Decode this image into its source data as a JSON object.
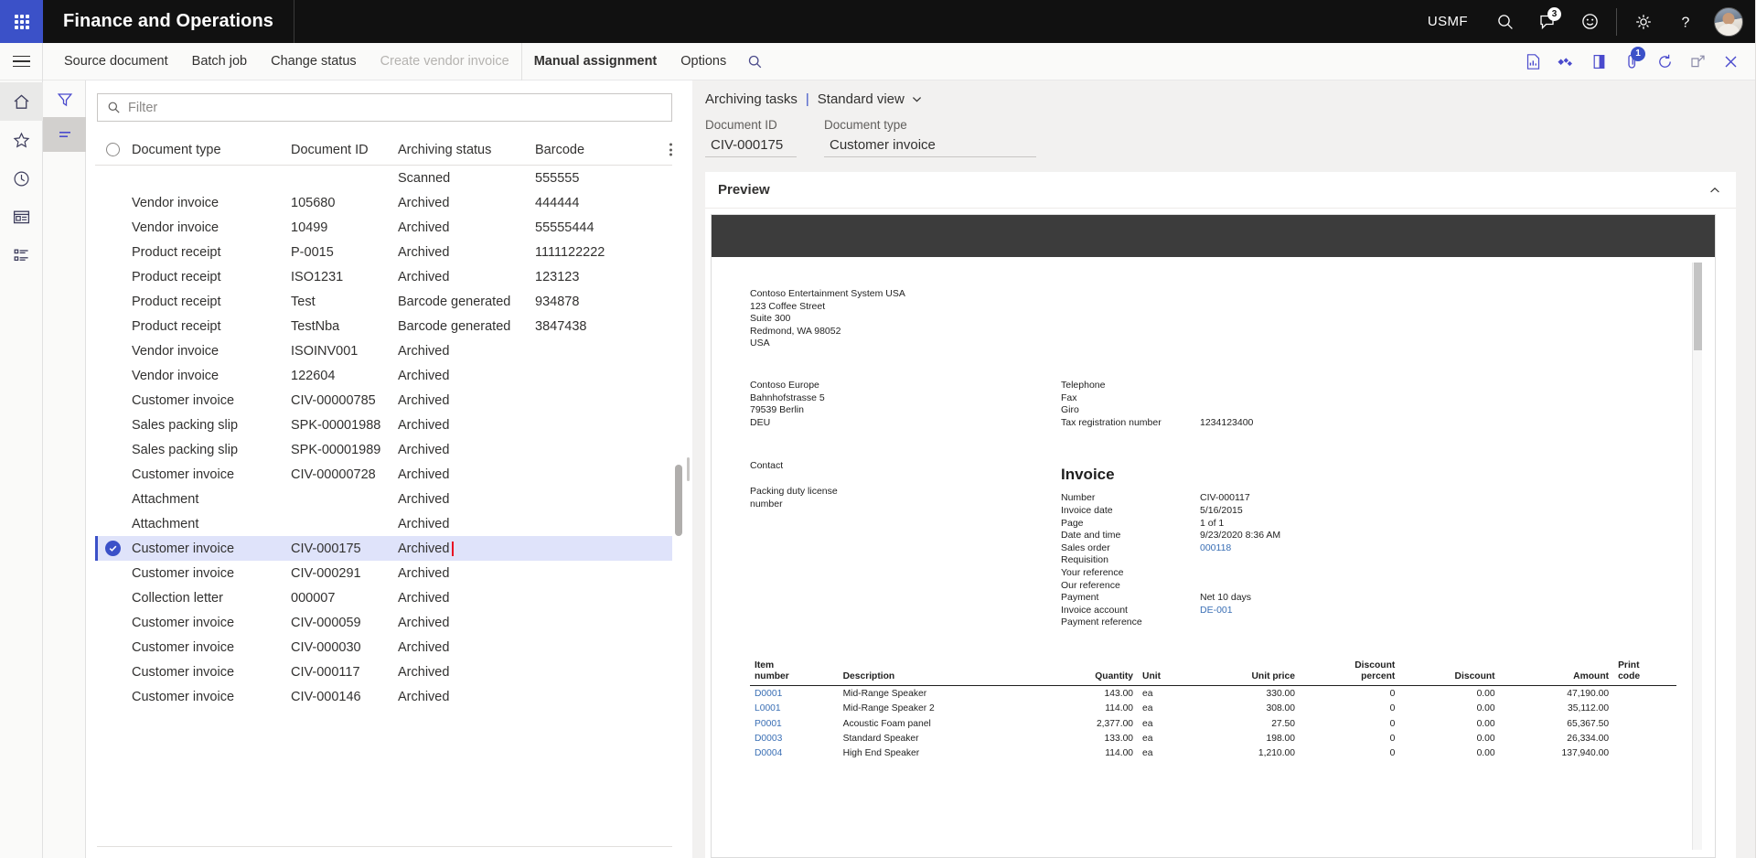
{
  "topbar": {
    "app_title": "Finance and Operations",
    "company": "USMF",
    "search_icon": "search-icon",
    "notifications_badge": "3",
    "feedback_icon": "smiley-icon",
    "settings_icon": "gear-icon",
    "help_icon": "question-mark-icon"
  },
  "toolbar": {
    "tabs": [
      {
        "label": "Source document",
        "state": "normal"
      },
      {
        "label": "Batch job",
        "state": "normal"
      },
      {
        "label": "Change status",
        "state": "normal"
      },
      {
        "label": "Create vendor invoice",
        "state": "disabled"
      },
      {
        "label": "Manual assignment",
        "state": "active"
      },
      {
        "label": "Options",
        "state": "normal"
      }
    ],
    "right_icons": [
      {
        "name": "report-icon",
        "badge": ""
      },
      {
        "name": "share-icon",
        "badge": ""
      },
      {
        "name": "book-icon",
        "badge": ""
      },
      {
        "name": "attachment-icon",
        "badge": "1"
      },
      {
        "name": "refresh-icon",
        "badge": ""
      },
      {
        "name": "open-in-new-icon",
        "badge": ""
      },
      {
        "name": "close-icon",
        "badge": ""
      }
    ]
  },
  "rail": {
    "items": [
      {
        "name": "home-icon"
      },
      {
        "name": "favorites-star-icon"
      },
      {
        "name": "recent-clock-icon"
      },
      {
        "name": "workspaces-icon"
      },
      {
        "name": "modules-list-icon"
      }
    ]
  },
  "filter_rail": {
    "items": [
      {
        "name": "filter-funnel-icon",
        "selected": false
      },
      {
        "name": "lines-view-icon",
        "selected": true
      }
    ]
  },
  "grid": {
    "filter_placeholder": "Filter",
    "filter_value": "",
    "columns": [
      "Document type",
      "Document ID",
      "Archiving status",
      "Barcode"
    ],
    "rows": [
      {
        "type": "",
        "id": "",
        "status": "Scanned",
        "barcode": "555555",
        "selected": false,
        "highlight": false
      },
      {
        "type": "Vendor invoice",
        "id": "105680",
        "status": "Archived",
        "barcode": "444444",
        "selected": false,
        "highlight": false
      },
      {
        "type": "Vendor invoice",
        "id": "10499",
        "status": "Archived",
        "barcode": "55555444",
        "selected": false,
        "highlight": false
      },
      {
        "type": "Product receipt",
        "id": "P-0015",
        "status": "Archived",
        "barcode": "1111122222",
        "selected": false,
        "highlight": false
      },
      {
        "type": "Product receipt",
        "id": "ISO1231",
        "status": "Archived",
        "barcode": "123123",
        "selected": false,
        "highlight": false
      },
      {
        "type": "Product receipt",
        "id": "Test",
        "status": "Barcode generated",
        "barcode": "934878",
        "selected": false,
        "highlight": false
      },
      {
        "type": "Product receipt",
        "id": "TestNba",
        "status": "Barcode generated",
        "barcode": "3847438",
        "selected": false,
        "highlight": false
      },
      {
        "type": "Vendor invoice",
        "id": "ISOINV001",
        "status": "Archived",
        "barcode": "",
        "selected": false,
        "highlight": false
      },
      {
        "type": "Vendor invoice",
        "id": "122604",
        "status": "Archived",
        "barcode": "",
        "selected": false,
        "highlight": false
      },
      {
        "type": "Customer invoice",
        "id": "CIV-00000785",
        "status": "Archived",
        "barcode": "",
        "selected": false,
        "highlight": false
      },
      {
        "type": "Sales packing slip",
        "id": "SPK-00001988",
        "status": "Archived",
        "barcode": "",
        "selected": false,
        "highlight": false
      },
      {
        "type": "Sales packing slip",
        "id": "SPK-00001989",
        "status": "Archived",
        "barcode": "",
        "selected": false,
        "highlight": false
      },
      {
        "type": "Customer invoice",
        "id": "CIV-00000728",
        "status": "Archived",
        "barcode": "",
        "selected": false,
        "highlight": false
      },
      {
        "type": "Attachment",
        "id": "",
        "status": "Archived",
        "barcode": "",
        "selected": false,
        "highlight": false
      },
      {
        "type": "Attachment",
        "id": "",
        "status": "Archived",
        "barcode": "",
        "selected": false,
        "highlight": false
      },
      {
        "type": "Customer invoice",
        "id": "CIV-000175",
        "status": "Archived",
        "barcode": "",
        "selected": true,
        "highlight": true
      },
      {
        "type": "Customer invoice",
        "id": "CIV-000291",
        "status": "Archived",
        "barcode": "",
        "selected": false,
        "highlight": false
      },
      {
        "type": "Collection letter",
        "id": "000007",
        "status": "Archived",
        "barcode": "",
        "selected": false,
        "highlight": false
      },
      {
        "type": "Customer invoice",
        "id": "CIV-000059",
        "status": "Archived",
        "barcode": "",
        "selected": false,
        "highlight": false
      },
      {
        "type": "Customer invoice",
        "id": "CIV-000030",
        "status": "Archived",
        "barcode": "",
        "selected": false,
        "highlight": false
      },
      {
        "type": "Customer invoice",
        "id": "CIV-000117",
        "status": "Archived",
        "barcode": "",
        "selected": false,
        "highlight": false
      },
      {
        "type": "Customer invoice",
        "id": "CIV-000146",
        "status": "Archived",
        "barcode": "",
        "selected": false,
        "highlight": false
      }
    ],
    "highlight_color": "#e81123"
  },
  "detail": {
    "breadcrumb_primary": "Archiving tasks",
    "breadcrumb_view": "Standard view",
    "fields": {
      "document_id_label": "Document ID",
      "document_id_value": "CIV-000175",
      "document_type_label": "Document type",
      "document_type_value": "Customer invoice"
    },
    "preview_title": "Preview"
  },
  "document": {
    "company_address": [
      "Contoso Entertainment System USA",
      "123 Coffee Street",
      "Suite 300",
      "Redmond, WA 98052",
      "USA"
    ],
    "customer_address": [
      "Contoso Europe",
      "Bahnhofstrasse 5",
      "79539 Berlin",
      "DEU"
    ],
    "contact_info": [
      {
        "k": "Telephone",
        "v": ""
      },
      {
        "k": "Fax",
        "v": ""
      },
      {
        "k": "Giro",
        "v": ""
      },
      {
        "k": "Tax registration number",
        "v": "1234123400"
      }
    ],
    "contact_label": "Contact",
    "packing_label": "Packing duty license\nnumber",
    "invoice_title": "Invoice",
    "invoice_meta": [
      {
        "k": "Number",
        "v": "CIV-000117",
        "link": false
      },
      {
        "k": "Invoice date",
        "v": "5/16/2015",
        "link": false
      },
      {
        "k": "Page",
        "v": "1      of   1",
        "link": false
      },
      {
        "k": "Date and time",
        "v": "9/23/2020 8:36 AM",
        "link": false
      },
      {
        "k": "Sales order",
        "v": "000118",
        "link": true
      },
      {
        "k": "Requisition",
        "v": "",
        "link": false
      },
      {
        "k": "Your reference",
        "v": "",
        "link": false
      },
      {
        "k": "Our reference",
        "v": "",
        "link": false
      },
      {
        "k": "Payment",
        "v": "Net 10 days",
        "link": false
      },
      {
        "k": "Invoice account",
        "v": "DE-001",
        "link": true
      },
      {
        "k": "Payment reference",
        "v": "",
        "link": false
      }
    ],
    "lines_headers": [
      "Item\nnumber",
      "Description",
      "Quantity",
      "Unit",
      "Unit price",
      "Discount\npercent",
      "Discount",
      "Amount",
      "Print\ncode"
    ],
    "lines": [
      {
        "item": "D0001",
        "desc": "Mid-Range Speaker",
        "qty": "143.00",
        "unit": "ea",
        "price": "330.00",
        "disc_pct": "0",
        "disc": "0.00",
        "amount": "47,190.00",
        "print": ""
      },
      {
        "item": "L0001",
        "desc": "Mid-Range Speaker 2",
        "qty": "114.00",
        "unit": "ea",
        "price": "308.00",
        "disc_pct": "0",
        "disc": "0.00",
        "amount": "35,112.00",
        "print": ""
      },
      {
        "item": "P0001",
        "desc": "Acoustic Foam panel",
        "qty": "2,377.00",
        "unit": "ea",
        "price": "27.50",
        "disc_pct": "0",
        "disc": "0.00",
        "amount": "65,367.50",
        "print": ""
      },
      {
        "item": "D0003",
        "desc": "Standard Speaker",
        "qty": "133.00",
        "unit": "ea",
        "price": "198.00",
        "disc_pct": "0",
        "disc": "0.00",
        "amount": "26,334.00",
        "print": ""
      },
      {
        "item": "D0004",
        "desc": "High End Speaker",
        "qty": "114.00",
        "unit": "ea",
        "price": "1,210.00",
        "disc_pct": "0",
        "disc": "0.00",
        "amount": "137,940.00",
        "print": ""
      }
    ]
  }
}
